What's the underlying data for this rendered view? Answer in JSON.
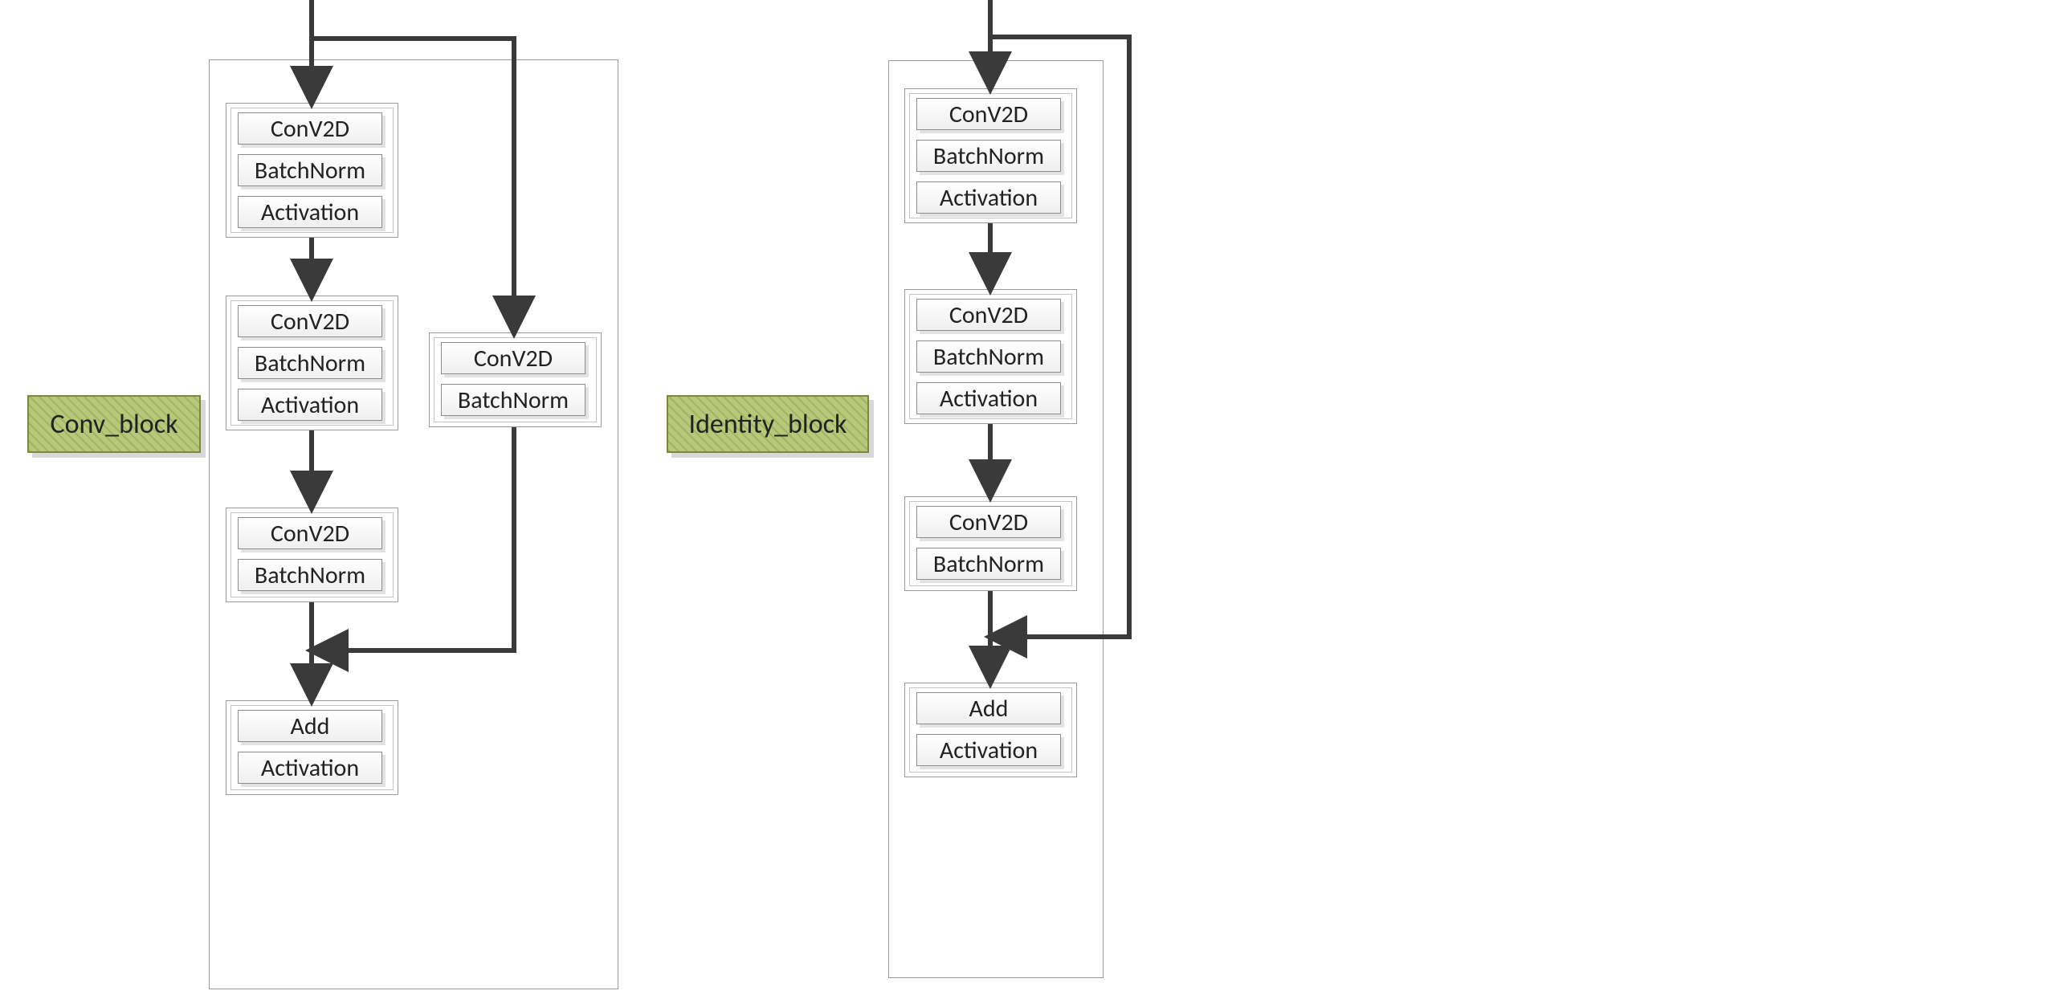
{
  "labels": {
    "conv_block": "Conv_block",
    "identity_block": "Identity_block"
  },
  "layers": {
    "conv2d": "ConV2D",
    "batchnorm": "BatchNorm",
    "activation": "Activation",
    "add": "Add"
  },
  "diagram": {
    "conv_block": {
      "main_path": [
        [
          "conv2d",
          "batchnorm",
          "activation"
        ],
        [
          "conv2d",
          "batchnorm",
          "activation"
        ],
        [
          "conv2d",
          "batchnorm"
        ],
        [
          "add",
          "activation"
        ]
      ],
      "shortcut_path": [
        [
          "conv2d",
          "batchnorm"
        ]
      ]
    },
    "identity_block": {
      "main_path": [
        [
          "conv2d",
          "batchnorm",
          "activation"
        ],
        [
          "conv2d",
          "batchnorm",
          "activation"
        ],
        [
          "conv2d",
          "batchnorm"
        ],
        [
          "add",
          "activation"
        ]
      ],
      "shortcut_path": "identity"
    }
  }
}
